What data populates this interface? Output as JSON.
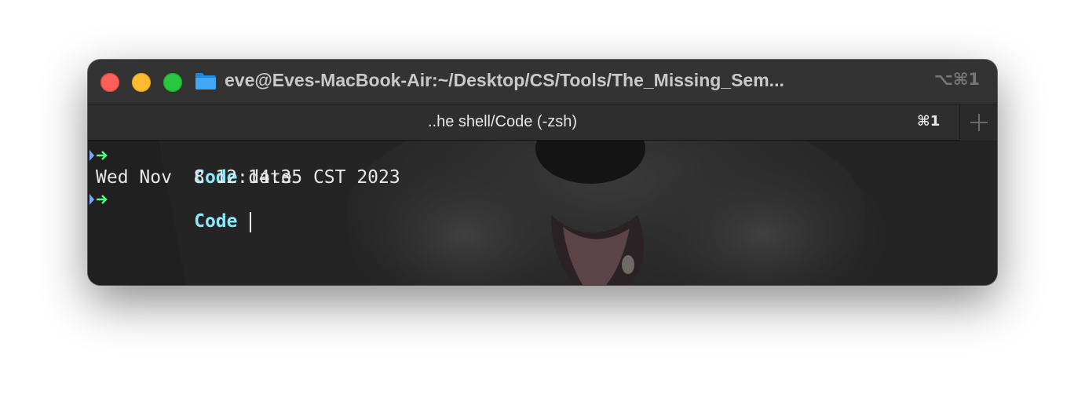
{
  "window": {
    "title": "eve@Eves-MacBook-Air:~/Desktop/CS/Tools/The_Missing_Sem...",
    "title_shortcut": "⌥⌘1",
    "folder_icon": "folder-icon",
    "controls": [
      "close",
      "minimize",
      "zoom"
    ]
  },
  "tabs": [
    {
      "label": "..he shell/Code (-zsh)",
      "shortcut": "⌘1",
      "active": true
    }
  ],
  "new_tab_icon": "plus-icon",
  "terminal": {
    "lines": [
      {
        "type": "prompt",
        "prompt_dir": "Code",
        "command": "date"
      },
      {
        "type": "output",
        "text": "Wed Nov  8 12:14:35 CST 2023"
      },
      {
        "type": "prompt",
        "prompt_dir": "Code",
        "command": ""
      }
    ],
    "prompt_icon": "arrow-right-icon"
  },
  "colors": {
    "prompt_dir": "#8be9fd",
    "prompt_arrow": "#50fa7b",
    "titlebar": "#333333",
    "terminal_bg": "#222322"
  }
}
